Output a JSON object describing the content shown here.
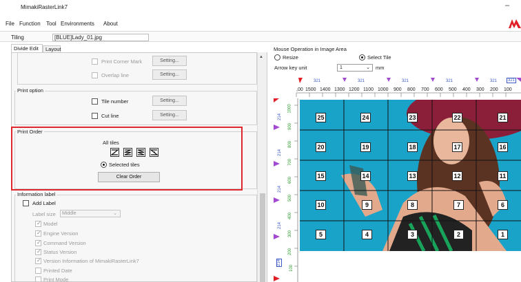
{
  "window": {
    "title": "MimakiRasterLink7",
    "minimize_glyph": "–",
    "brand_color": "#e01f26"
  },
  "menu": [
    "File",
    "Function",
    "Tool",
    "Environments",
    "About"
  ],
  "tiling": {
    "label": "Tiling",
    "value": "[BLUE]Lady_01.jpg"
  },
  "tabs": [
    "Divide Edit",
    "Layout"
  ],
  "top_group": {
    "print_corner_mark": "Print Corner Mark",
    "overlap_line": "Overlap line",
    "setting": "Setting..."
  },
  "print_option": {
    "title": "Print option",
    "tile_number": "Tile number",
    "cut_line": "Cut line",
    "setting": "Setting..."
  },
  "print_order": {
    "title": "Print Order",
    "all_tiles": "All tiles",
    "icons": [
      "order-z-icon",
      "order-s-icon",
      "order-reverse-s-icon",
      "order-reverse-z-icon"
    ],
    "selected_tiles": "Selected tiles",
    "clear_order": "Clear Order"
  },
  "info_label": {
    "title": "Information label",
    "add_label": "Add Label",
    "label_size": "Label size",
    "label_size_value": "Middle",
    "items": [
      "Model",
      "Engine Version",
      "Command Version",
      "Status Version",
      "Version Information of MimakiRasterLink7",
      "Printed Date",
      "Print Mode"
    ],
    "items_checked": [
      true,
      true,
      true,
      true,
      true,
      false,
      false
    ]
  },
  "mouse_op": {
    "title": "Mouse Operation in Image Area",
    "resize": "Resize",
    "select_tile": "Select Tile",
    "arrow_key_unit": "Arrow key unit",
    "arrow_value": "1",
    "unit": "mm"
  },
  "ruler_top": [
    "321",
    "321",
    "321",
    "321",
    "321",
    "321"
  ],
  "ruler_top_numbers": [
    ",00",
    "1500",
    "1400",
    "1300",
    "1200",
    "1100",
    "1000",
    "900",
    "800",
    "700",
    "600",
    "500",
    "400",
    "300",
    "200",
    "100"
  ],
  "ruler_left_marks": [
    "214",
    "214",
    "214",
    "214",
    "214"
  ],
  "ruler_left_scale": [
    "1000",
    "900",
    "800",
    "700",
    "600",
    "500",
    "400",
    "300",
    "200",
    "100"
  ],
  "tiles": [
    [
      "25",
      "24",
      "23",
      "22",
      "21"
    ],
    [
      "20",
      "19",
      "18",
      "17",
      "16"
    ],
    [
      "15",
      "14",
      "13",
      "12",
      "11"
    ],
    [
      "10",
      "9",
      "8",
      "7",
      "6"
    ],
    [
      "5",
      "4",
      "3",
      "2",
      "1"
    ]
  ],
  "colors": {
    "highlight": "#e0262a",
    "ruler_marker": "#a24bd0",
    "image_bg": "#1aa3c9"
  }
}
